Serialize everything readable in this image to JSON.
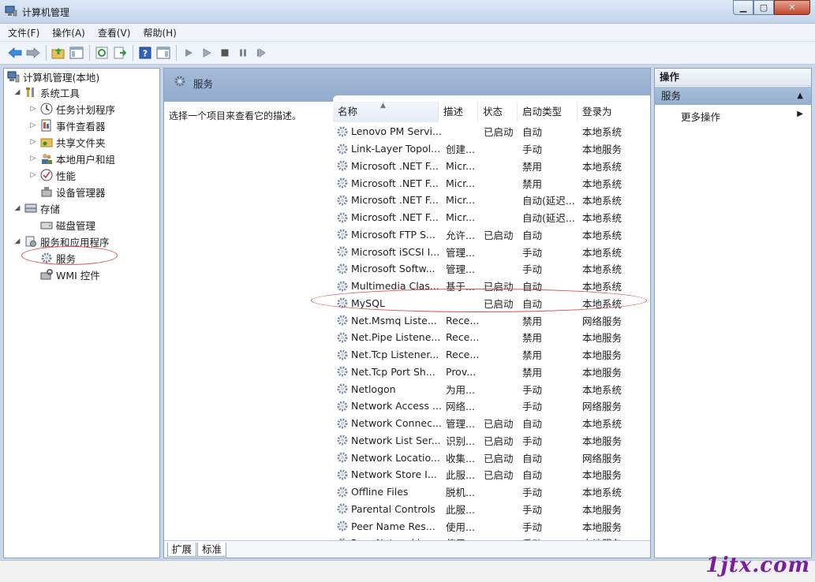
{
  "window": {
    "title": "计算机管理"
  },
  "menu": [
    "文件(F)",
    "操作(A)",
    "查看(V)",
    "帮助(H)"
  ],
  "tree": {
    "root": "计算机管理(本地)",
    "system_tools": "系统工具",
    "task_scheduler": "任务计划程序",
    "event_viewer": "事件查看器",
    "shared_folders": "共享文件夹",
    "local_users": "本地用户和组",
    "performance": "性能",
    "device_manager": "设备管理器",
    "storage": "存储",
    "disk_management": "磁盘管理",
    "services_apps": "服务和应用程序",
    "services": "服务",
    "wmi": "WMI 控件"
  },
  "center": {
    "header_title": "服务",
    "description": "选择一个项目来查看它的描述。",
    "columns": {
      "name": "名称",
      "desc": "描述",
      "state": "状态",
      "startup": "启动类型",
      "logon": "登录为"
    },
    "services": [
      {
        "name": "Lenovo PM Servi...",
        "desc": "",
        "state": "已启动",
        "startup": "自动",
        "logon": "本地系统"
      },
      {
        "name": "Link-Layer Topol...",
        "desc": "创建...",
        "state": "",
        "startup": "手动",
        "logon": "本地服务"
      },
      {
        "name": "Microsoft .NET F...",
        "desc": "Micr...",
        "state": "",
        "startup": "禁用",
        "logon": "本地系统"
      },
      {
        "name": "Microsoft .NET F...",
        "desc": "Micr...",
        "state": "",
        "startup": "禁用",
        "logon": "本地系统"
      },
      {
        "name": "Microsoft .NET F...",
        "desc": "Micr...",
        "state": "",
        "startup": "自动(延迟...",
        "logon": "本地系统"
      },
      {
        "name": "Microsoft .NET F...",
        "desc": "Micr...",
        "state": "",
        "startup": "自动(延迟...",
        "logon": "本地系统"
      },
      {
        "name": "Microsoft FTP S...",
        "desc": "允许...",
        "state": "已启动",
        "startup": "自动",
        "logon": "本地系统"
      },
      {
        "name": "Microsoft iSCSI I...",
        "desc": "管理...",
        "state": "",
        "startup": "手动",
        "logon": "本地系统"
      },
      {
        "name": "Microsoft Softw...",
        "desc": "管理...",
        "state": "",
        "startup": "手动",
        "logon": "本地系统"
      },
      {
        "name": "Multimedia Clas...",
        "desc": "基于...",
        "state": "已启动",
        "startup": "自动",
        "logon": "本地系统"
      },
      {
        "name": "MySQL",
        "desc": "",
        "state": "已启动",
        "startup": "自动",
        "logon": "本地系统"
      },
      {
        "name": "Net.Msmq Liste...",
        "desc": "Rece...",
        "state": "",
        "startup": "禁用",
        "logon": "网络服务"
      },
      {
        "name": "Net.Pipe Listene...",
        "desc": "Rece...",
        "state": "",
        "startup": "禁用",
        "logon": "本地服务"
      },
      {
        "name": "Net.Tcp Listener...",
        "desc": "Rece...",
        "state": "",
        "startup": "禁用",
        "logon": "本地服务"
      },
      {
        "name": "Net.Tcp Port Sh...",
        "desc": "Prov...",
        "state": "",
        "startup": "禁用",
        "logon": "本地服务"
      },
      {
        "name": "Netlogon",
        "desc": "为用...",
        "state": "",
        "startup": "手动",
        "logon": "本地系统"
      },
      {
        "name": "Network Access ...",
        "desc": "网络...",
        "state": "",
        "startup": "手动",
        "logon": "网络服务"
      },
      {
        "name": "Network Connec...",
        "desc": "管理...",
        "state": "已启动",
        "startup": "自动",
        "logon": "本地系统"
      },
      {
        "name": "Network List Ser...",
        "desc": "识别...",
        "state": "已启动",
        "startup": "手动",
        "logon": "本地服务"
      },
      {
        "name": "Network Locatio...",
        "desc": "收集...",
        "state": "已启动",
        "startup": "自动",
        "logon": "网络服务"
      },
      {
        "name": "Network Store I...",
        "desc": "此服...",
        "state": "已启动",
        "startup": "自动",
        "logon": "本地服务"
      },
      {
        "name": "Offline Files",
        "desc": "脱机...",
        "state": "",
        "startup": "手动",
        "logon": "本地系统"
      },
      {
        "name": "Parental Controls",
        "desc": "此服...",
        "state": "",
        "startup": "手动",
        "logon": "本地服务"
      },
      {
        "name": "Peer Name Res...",
        "desc": "使用...",
        "state": "",
        "startup": "手动",
        "logon": "本地服务"
      },
      {
        "name": "Peer Networki...",
        "desc": "使用...",
        "state": "",
        "startup": "手动",
        "logon": "本地服务"
      }
    ],
    "tabs": {
      "extended": "扩展",
      "standard": "标准"
    }
  },
  "actions": {
    "header": "操作",
    "group": "服务",
    "more": "更多操作"
  },
  "watermark": "1jtx.com"
}
